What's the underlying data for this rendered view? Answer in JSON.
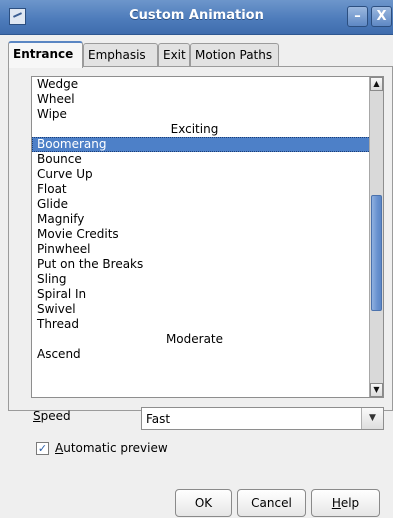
{
  "window": {
    "title": "Custom Animation",
    "minimize": "–",
    "close": "X"
  },
  "tabs": [
    {
      "label": "Entrance",
      "active": true
    },
    {
      "label": "Emphasis",
      "active": false
    },
    {
      "label": "Exit",
      "active": false
    },
    {
      "label": "Motion Paths",
      "active": false
    }
  ],
  "effects_list": {
    "rows": [
      {
        "text": "Wedge",
        "kind": "item"
      },
      {
        "text": "Wheel",
        "kind": "item"
      },
      {
        "text": "Wipe",
        "kind": "item"
      },
      {
        "text": "Exciting",
        "kind": "header"
      },
      {
        "text": "Boomerang",
        "kind": "item",
        "selected": true
      },
      {
        "text": "Bounce",
        "kind": "item"
      },
      {
        "text": "Curve Up",
        "kind": "item"
      },
      {
        "text": "Float",
        "kind": "item"
      },
      {
        "text": "Glide",
        "kind": "item"
      },
      {
        "text": "Magnify",
        "kind": "item"
      },
      {
        "text": "Movie Credits",
        "kind": "item"
      },
      {
        "text": "Pinwheel",
        "kind": "item"
      },
      {
        "text": "Put on the Breaks",
        "kind": "item"
      },
      {
        "text": "Sling",
        "kind": "item"
      },
      {
        "text": "Spiral In",
        "kind": "item"
      },
      {
        "text": "Swivel",
        "kind": "item"
      },
      {
        "text": "Thread",
        "kind": "item"
      },
      {
        "text": "Moderate",
        "kind": "header"
      },
      {
        "text": "Ascend",
        "kind": "item"
      }
    ]
  },
  "speed": {
    "label_prefix": "",
    "label_mnemonic": "S",
    "label_rest": "peed",
    "value": "Fast"
  },
  "automatic_preview": {
    "mnemonic": "A",
    "rest": "utomatic preview",
    "checked": true
  },
  "buttons": {
    "ok": "OK",
    "cancel": "Cancel",
    "help_mnemonic": "H",
    "help_rest": "elp"
  },
  "colors": {
    "selection": "#4d80c8",
    "titlebar": "#4e7cbb"
  }
}
